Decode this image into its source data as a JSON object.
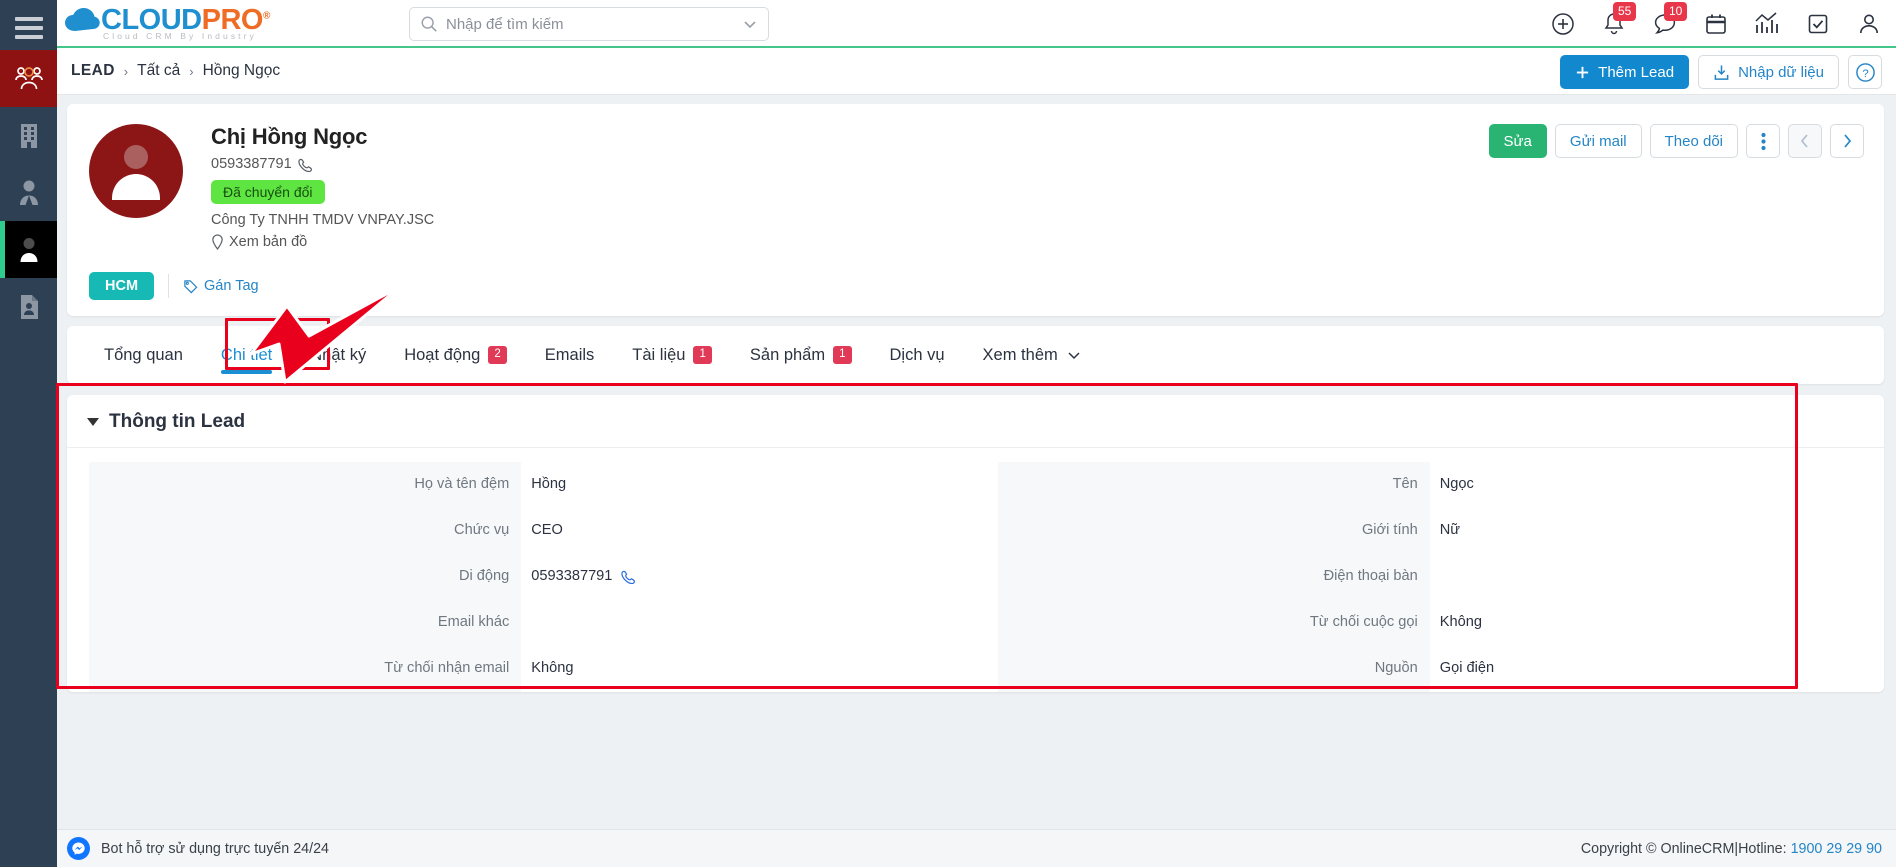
{
  "sidebar": {
    "burger": "menu-icon",
    "items": [
      {
        "name": "sidebar-item-customers",
        "icon": "people-group-icon",
        "state": "highlighted"
      },
      {
        "name": "sidebar-item-company",
        "icon": "building-icon",
        "state": "normal"
      },
      {
        "name": "sidebar-item-contacts",
        "icon": "person-tie-icon",
        "state": "normal"
      },
      {
        "name": "sidebar-item-leads",
        "icon": "person-icon",
        "state": "active"
      },
      {
        "name": "sidebar-item-documents",
        "icon": "id-card-icon",
        "state": "normal"
      }
    ]
  },
  "header": {
    "logo_main": "CLOUD",
    "logo_accent": "PRO",
    "logo_reg": "®",
    "logo_tagline": "Cloud CRM By Industry",
    "search": {
      "placeholder": "Nhập để tìm kiếm",
      "value": ""
    },
    "icons": [
      {
        "name": "add-circle-icon",
        "badge": ""
      },
      {
        "name": "bell-icon",
        "badge": "55"
      },
      {
        "name": "chat-icon",
        "badge": "10"
      },
      {
        "name": "calendar-icon",
        "badge": ""
      },
      {
        "name": "chart-icon",
        "badge": ""
      },
      {
        "name": "task-check-icon",
        "badge": ""
      },
      {
        "name": "user-account-icon",
        "badge": ""
      }
    ]
  },
  "breadcrumb": {
    "module": "LEAD",
    "items": [
      "Tất cả",
      "Hồng Ngọc"
    ],
    "separator": "›"
  },
  "page_actions": {
    "add_lead": "Thêm Lead",
    "add_lead_icon": "plus-icon",
    "import": "Nhập dữ liệu",
    "import_icon": "download-icon",
    "help_icon": "question-circle-icon"
  },
  "profile": {
    "name": "Chị Hồng Ngọc",
    "phone": "0593387791",
    "phone_icon": "phone-icon",
    "status": "Đã chuyển đổi",
    "company": "Công Ty TNHH TMDV VNPAY.JSC",
    "map_link": "Xem bản đồ",
    "map_icon": "map-pin-icon",
    "tag": "HCM",
    "tag_add": "Gán Tag",
    "tag_add_icon": "tag-icon",
    "actions": {
      "edit": "Sửa",
      "send_mail": "Gửi mail",
      "follow": "Theo dõi",
      "more_icon": "vertical-dots-icon",
      "prev_icon": "chevron-left-icon",
      "next_icon": "chevron-right-icon"
    }
  },
  "tabs": [
    {
      "label": "Tổng quan",
      "badge": "",
      "active": false
    },
    {
      "label": "Chi tiết",
      "badge": "",
      "active": true
    },
    {
      "label": "Nhật ký",
      "badge": "",
      "active": false
    },
    {
      "label": "Hoạt động",
      "badge": "2",
      "active": false
    },
    {
      "label": "Emails",
      "badge": "",
      "active": false
    },
    {
      "label": "Tài liệu",
      "badge": "1",
      "active": false
    },
    {
      "label": "Sản phẩm",
      "badge": "1",
      "active": false
    },
    {
      "label": "Dịch vụ",
      "badge": "",
      "active": false
    },
    {
      "label": "Xem thêm",
      "badge": "",
      "active": false,
      "icon": "chevron-down-icon"
    }
  ],
  "detail": {
    "section_title": "Thông tin Lead",
    "collapse_icon": "triangle-down-icon",
    "left_fields": [
      {
        "label": "Họ và tên đệm",
        "value": "Hồng",
        "icon": ""
      },
      {
        "label": "Chức vụ",
        "value": "CEO",
        "icon": ""
      },
      {
        "label": "Di động",
        "value": "0593387791",
        "icon": "phone-icon"
      },
      {
        "label": "Email khác",
        "value": "",
        "icon": ""
      },
      {
        "label": "Từ chối nhận email",
        "value": "Không",
        "icon": ""
      }
    ],
    "right_fields": [
      {
        "label": "Tên",
        "value": "Ngọc",
        "icon": ""
      },
      {
        "label": "Giới tính",
        "value": "Nữ",
        "icon": ""
      },
      {
        "label": "Điện thoại bàn",
        "value": "",
        "icon": ""
      },
      {
        "label": "Từ chối cuộc gọi",
        "value": "Không",
        "icon": ""
      },
      {
        "label": "Nguồn",
        "value": "Gọi điện",
        "icon": ""
      }
    ]
  },
  "footer": {
    "bot_text": "Bot hỗ trợ sử dụng trực tuyến 24/24",
    "bot_icon": "messenger-icon",
    "copyright": "Copyright © OnlineCRM",
    "separator": "|",
    "hotline_label": "Hotline:",
    "hotline": "1900 29 29 90"
  },
  "annotations": {
    "tab_highlight_color": "#e8001c",
    "panel_highlight_color": "#e8001c",
    "arrow_color": "#e8001c"
  }
}
